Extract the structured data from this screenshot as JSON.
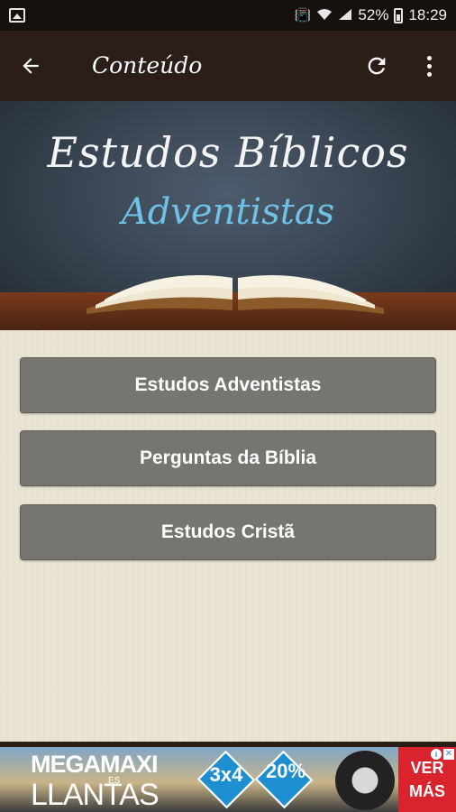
{
  "status_bar": {
    "battery_percent": "52%",
    "time": "18:29",
    "icons": [
      "image-icon",
      "vibrate-icon",
      "wifi-icon",
      "signal-icon",
      "battery-icon"
    ]
  },
  "app_bar": {
    "title": "Conteúdo",
    "icons": [
      "arrow-back-icon",
      "refresh-icon",
      "more-vert-icon"
    ]
  },
  "banner": {
    "line1": "Estudos Bíblicos",
    "line2": "Adventistas"
  },
  "menu": {
    "items": [
      {
        "label": "Estudos Adventistas"
      },
      {
        "label": "Perguntas da Bíblia"
      },
      {
        "label": "Estudos Cristã"
      }
    ]
  },
  "ad": {
    "brand_line1": "MEGAMAXI",
    "brand_small": "ES",
    "brand_line2": "LLANTAS",
    "promo1": "3x4",
    "promo2": "20%",
    "cta": "VER MÁS"
  },
  "colors": {
    "status_bar": "#17110e",
    "app_bar": "#2b1e18",
    "button_bg": "#777570",
    "content_bg": "#eae5d4",
    "banner_title": "#f4f4f4",
    "banner_subtitle": "#6fc2e6"
  }
}
